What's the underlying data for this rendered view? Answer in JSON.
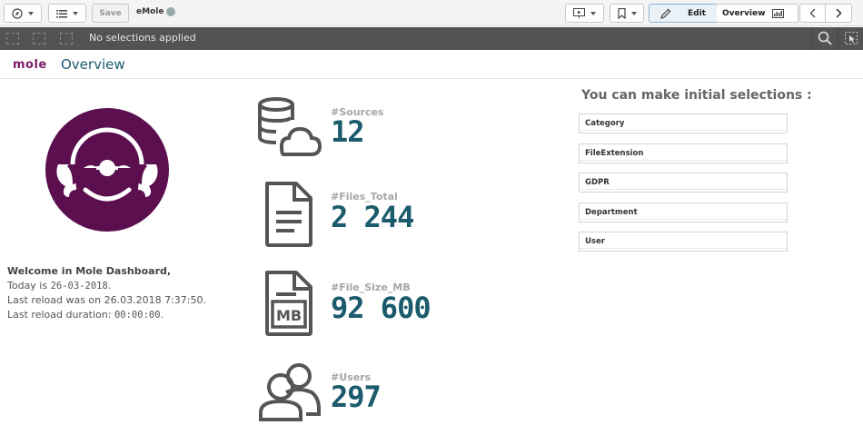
{
  "toolbar": {
    "save_label": "Save",
    "app_name": "eMole",
    "edit_label": "Edit",
    "sheet_label": "Overview"
  },
  "selections": {
    "status": "No selections applied"
  },
  "header": {
    "logo": "mole",
    "title": "Overview"
  },
  "welcome": {
    "line1": "Welcome in Mole Dashboard,",
    "line2_prefix": "Today is ",
    "date": "26-03-2018",
    "line2_suffix": ".",
    "line3": "Last reload was on 26.03.2018 7:37:50.",
    "line4_prefix": "Last reload duration: ",
    "duration": "00:00:00",
    "line4_suffix": "."
  },
  "kpis": [
    {
      "label": "#Sources",
      "value": "12",
      "icon": "database-cloud-icon"
    },
    {
      "label": "#Files_Total",
      "value": "2 244",
      "icon": "document-icon"
    },
    {
      "label": "#File_Size_MB",
      "value": "92 600",
      "icon": "mb-file-icon"
    },
    {
      "label": "#Users",
      "value": "297",
      "icon": "users-icon"
    }
  ],
  "filters": {
    "title": "You can make initial selections :",
    "items": [
      "Category",
      "FileExtension",
      "GDPR",
      "Department",
      "User"
    ]
  },
  "colors": {
    "accent": "#1b5b6c",
    "brand": "#5b0f4f",
    "label_gray": "#a6a6a6"
  }
}
